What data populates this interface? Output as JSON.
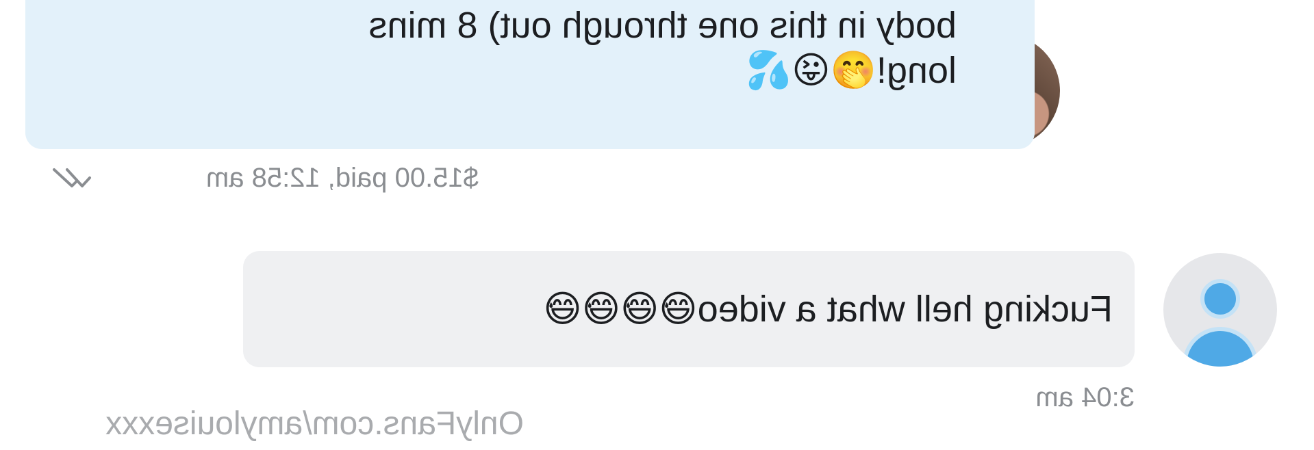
{
  "creator_message": {
    "text_line_1": "body in this one through out) 8 mins",
    "text_line_2": "long!",
    "emojis": [
      "🤭",
      "😜",
      "💦"
    ],
    "status_text": "$15.00 paid, 12:58 am",
    "read_icon": "double-check-icon",
    "bubble_color": "#e3f1fa"
  },
  "fan_message": {
    "text": "Fucking hell what a video",
    "emojis": [
      "😅",
      "😅",
      "😅",
      "😅"
    ],
    "timestamp": "3:04 am",
    "bubble_color": "#eff0f2"
  },
  "avatars": {
    "creator": "creator-avatar-photo",
    "fan": "default-user-icon",
    "fan_icon_color": "#4fa9e6"
  },
  "watermark": {
    "text": "OnlyFans.com/amylouisexxx"
  }
}
